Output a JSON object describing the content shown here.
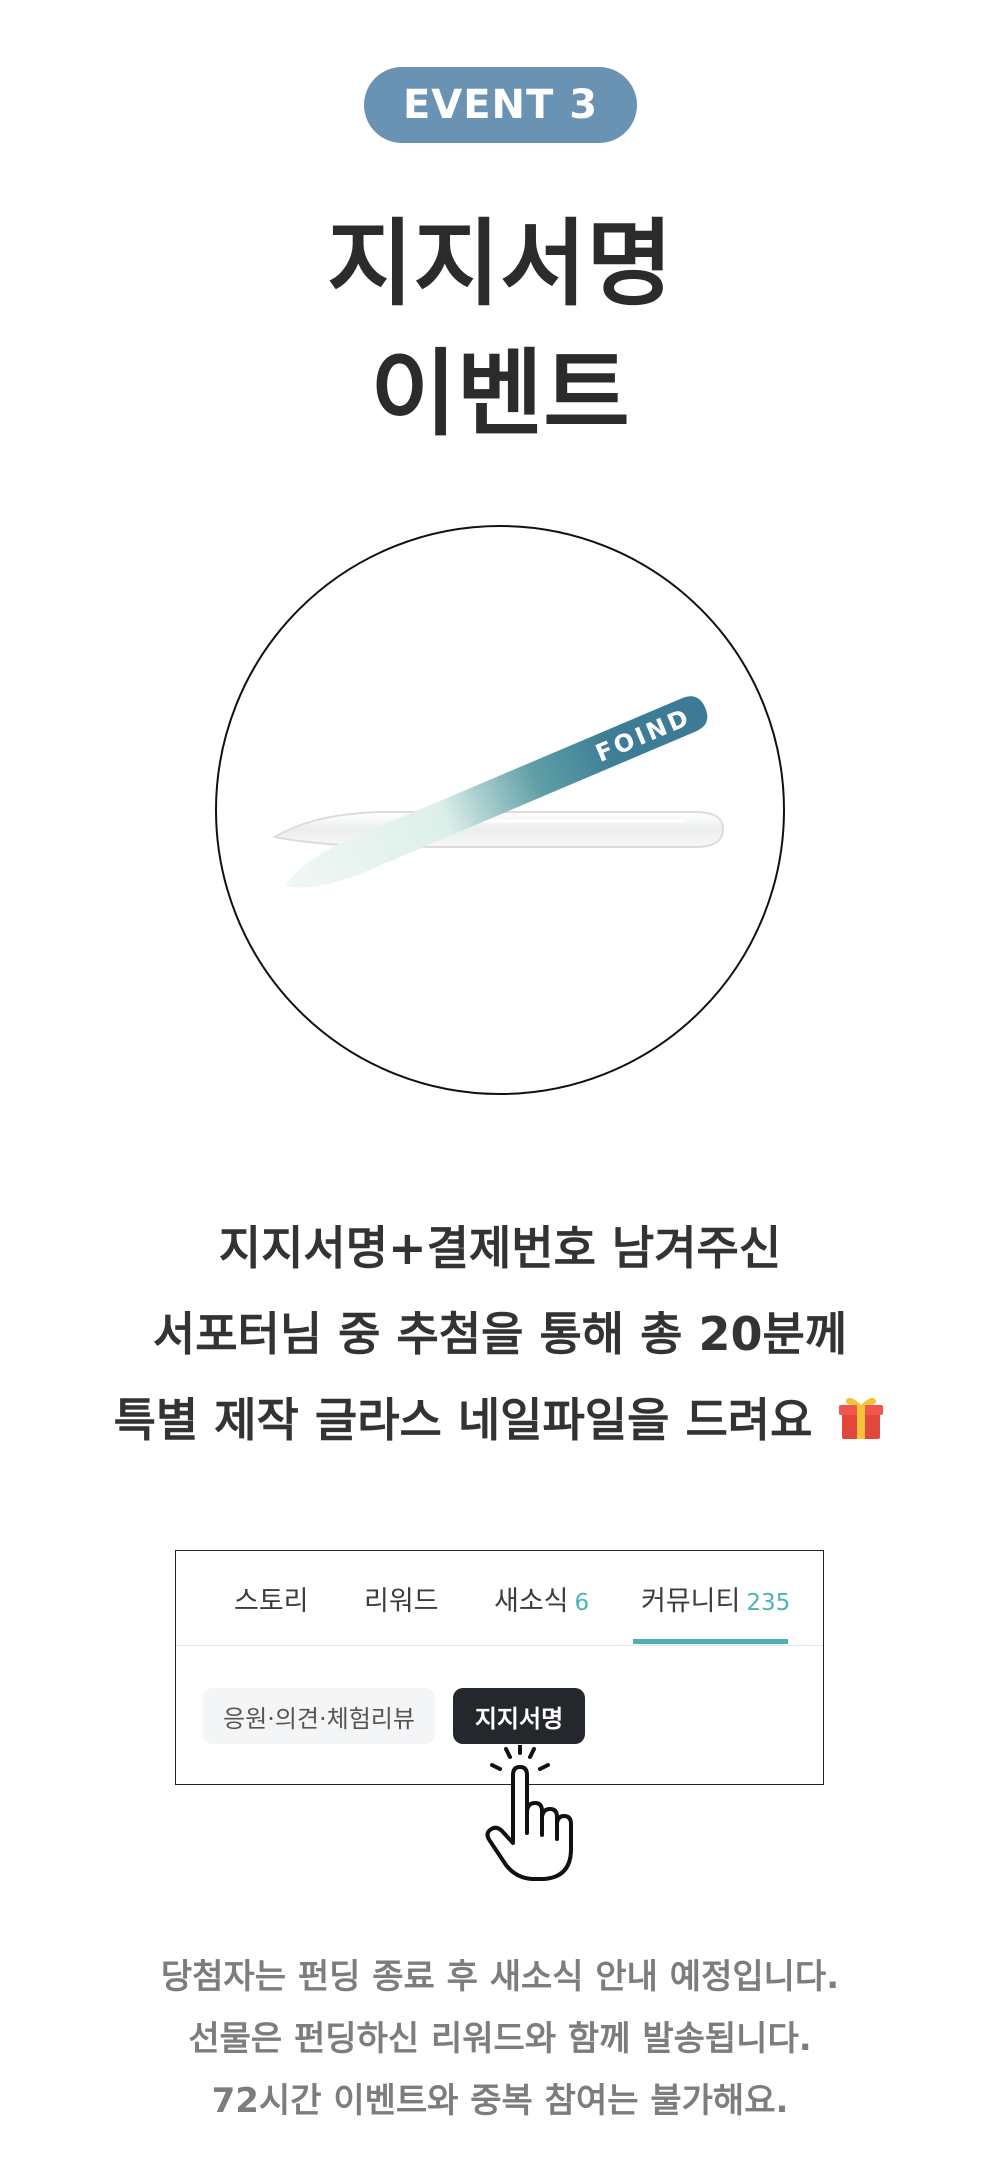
{
  "badge": {
    "label": "EVENT 3"
  },
  "title": {
    "line1": "지지서명",
    "line2": "이벤트"
  },
  "product": {
    "brand_text": "FOIND",
    "icon": "nail-file-image"
  },
  "description": {
    "line1": "지지서명+결제번호 남겨주신",
    "line2": "서포터님 중 추첨을 통해 총 20분께",
    "line3": "특별 제작 글라스 네일파일을 드려요",
    "emoji_icon": "gift-icon"
  },
  "panel": {
    "tabs": [
      {
        "label": "스토리",
        "count": ""
      },
      {
        "label": "리워드",
        "count": ""
      },
      {
        "label": "새소식",
        "count": "6"
      },
      {
        "label": "커뮤니티",
        "count": "235",
        "active": true
      }
    ],
    "chips": [
      {
        "label": "응원·의견·체험리뷰",
        "active": false
      },
      {
        "label": "지지서명",
        "active": true
      }
    ],
    "accent_color": "#4cb0b0"
  },
  "notes": {
    "line1": "당첨자는 펀딩 종료 후 새소식 안내 예정입니다.",
    "line2": "선물은 펀딩하신 리워드와 함께 발송됩니다.",
    "line3": "72시간 이벤트와 중복 참여는 불가해요."
  },
  "colors": {
    "badge": "#6a93b3",
    "title": "#2b2b2b",
    "notes": "#7d7d7d"
  }
}
